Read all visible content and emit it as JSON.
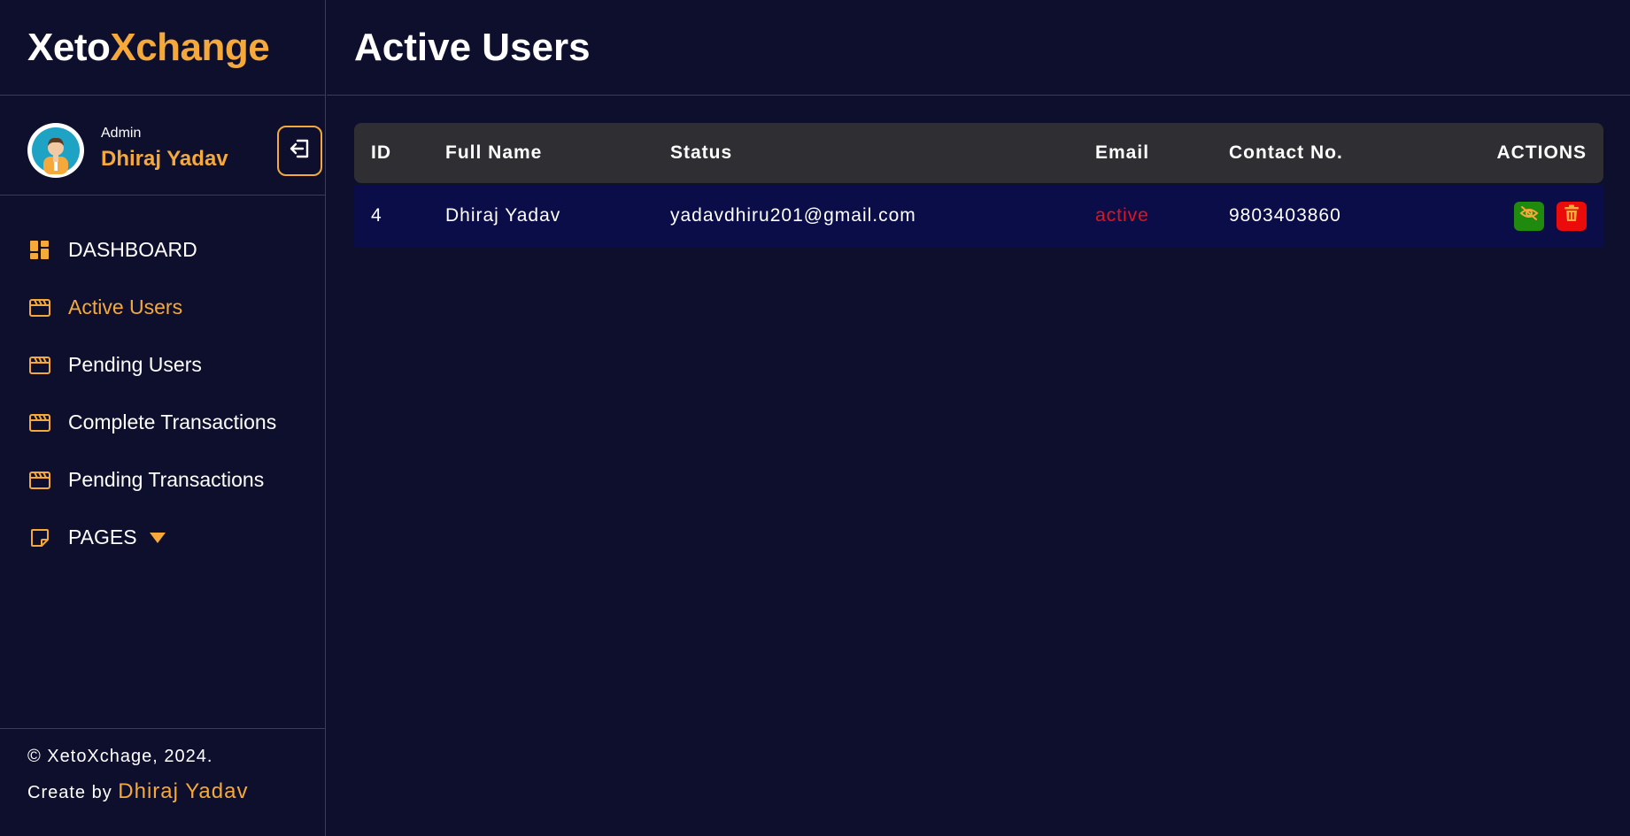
{
  "brand": {
    "part1": "Xeto",
    "part2": "Xchange"
  },
  "profile": {
    "role": "Admin",
    "name": "Dhiraj Yadav"
  },
  "nav": [
    {
      "label": "DASHBOARD",
      "icon": "dashboard-icon"
    },
    {
      "label": "Active Users",
      "icon": "window-icon",
      "active": true
    },
    {
      "label": "Pending Users",
      "icon": "window-icon"
    },
    {
      "label": "Complete Transactions",
      "icon": "window-icon"
    },
    {
      "label": "Pending Transactions",
      "icon": "window-icon"
    },
    {
      "label": "PAGES",
      "icon": "note-icon"
    }
  ],
  "footer": {
    "copyright": "© XetoXchage, 2024.",
    "created_by": "Create by",
    "author": "Dhiraj Yadav"
  },
  "page": {
    "title": "Active Users"
  },
  "table": {
    "headers": {
      "id": "ID",
      "name": "Full Name",
      "status": "Status",
      "email": "Email",
      "contact": "Contact No.",
      "actions": "ACTIONS"
    },
    "rows": [
      {
        "id": "4",
        "name": "Dhiraj Yadav",
        "status": "yadavdhiru201@gmail.com",
        "email": "active",
        "contact": "9803403860"
      }
    ]
  },
  "colors": {
    "accent": "#f6a93b",
    "background": "#0d0f2d",
    "row": "#0a0d47",
    "header": "#2e2e33",
    "danger": "#ec0b0b",
    "success": "#1f8a0d"
  }
}
